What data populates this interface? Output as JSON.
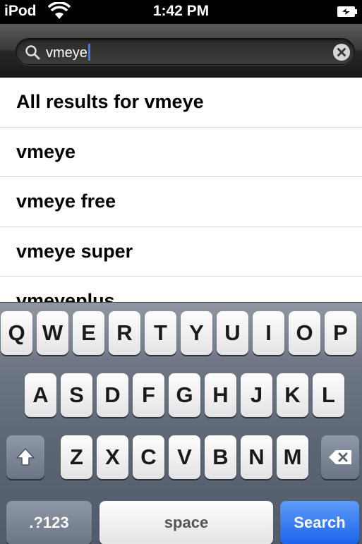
{
  "status_bar": {
    "carrier": "iPod",
    "wifi_icon": "wifi-icon",
    "time": "1:42 PM",
    "battery_icon": "battery-charging-icon"
  },
  "search": {
    "query": "vmeye",
    "search_icon": "magnifier-icon",
    "clear_icon": "clear-icon"
  },
  "results": [
    "All results for vmeye",
    "vmeye",
    "vmeye free",
    "vmeye super",
    "vmeyeplus"
  ],
  "keyboard": {
    "row1": [
      "Q",
      "W",
      "E",
      "R",
      "T",
      "Y",
      "U",
      "I",
      "O",
      "P"
    ],
    "row2": [
      "A",
      "S",
      "D",
      "F",
      "G",
      "H",
      "J",
      "K",
      "L"
    ],
    "row3": [
      "Z",
      "X",
      "C",
      "V",
      "B",
      "N",
      "M"
    ],
    "shift_icon": "shift-icon",
    "delete_icon": "backspace-icon",
    "numbers_key": ".?123",
    "space_key": "space",
    "search_key": "Search",
    "colors": {
      "search_key": "#1c63ea",
      "cursor": "#3c7bf5"
    }
  }
}
